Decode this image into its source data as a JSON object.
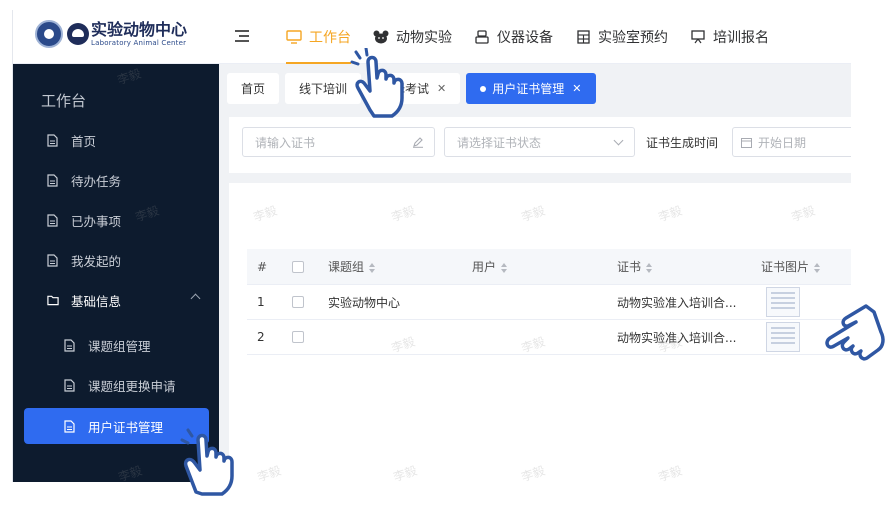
{
  "brand": {
    "name_cn": "实验动物中心",
    "name_en": "Laboratory Animal Center"
  },
  "topnav": [
    {
      "label": "工作台",
      "icon": "monitor-icon",
      "active": true
    },
    {
      "label": "动物实验",
      "icon": "mouse-face-icon",
      "active": false
    },
    {
      "label": "仪器设备",
      "icon": "instrument-icon",
      "active": false
    },
    {
      "label": "实验室预约",
      "icon": "calendar-grid-icon",
      "active": false
    },
    {
      "label": "培训报名",
      "icon": "presentation-board-icon",
      "active": false
    }
  ],
  "sidebar": {
    "title": "工作台",
    "items": [
      {
        "label": "首页",
        "icon": "document-icon"
      },
      {
        "label": "待办任务",
        "icon": "document-icon"
      },
      {
        "label": "已办事项",
        "icon": "document-icon"
      },
      {
        "label": "我发起的",
        "icon": "document-icon"
      }
    ],
    "group": {
      "label": "基础信息",
      "icon": "folder-icon",
      "expanded": true,
      "children": [
        {
          "label": "课题组管理",
          "icon": "document-icon",
          "active": false
        },
        {
          "label": "课题组更换申请",
          "icon": "document-icon",
          "active": false
        },
        {
          "label": "用户证书管理",
          "icon": "document-icon",
          "active": true
        }
      ]
    }
  },
  "tabs": [
    {
      "label": "首页",
      "closable": false,
      "active": false
    },
    {
      "label": "线下培训",
      "closable": false,
      "active": false
    },
    {
      "label": "选择考试",
      "closable": true,
      "active": false
    },
    {
      "label": "用户证书管理",
      "closable": true,
      "active": true
    }
  ],
  "filters": {
    "certificate_placeholder": "请输入证书",
    "status_placeholder": "请选择证书状态",
    "generated_time_label": "证书生成时间",
    "start_date_placeholder": "开始日期"
  },
  "table": {
    "columns": {
      "index": "#",
      "group": "课题组",
      "user": "用户",
      "certificate": "证书",
      "image": "证书图片"
    },
    "rows": [
      {
        "index": "1",
        "group": "实验动物中心",
        "user": "",
        "certificate": "动物实验准入培训合..."
      },
      {
        "index": "2",
        "group": "",
        "user": "",
        "certificate": "动物实验准入培训合..."
      }
    ]
  },
  "watermark": "李毅",
  "colors": {
    "accent": "#2f6bf0",
    "active_nav": "#f5a623",
    "sidebar_bg": "#0d1b2e",
    "pointer_stroke": "#2f57a3"
  }
}
